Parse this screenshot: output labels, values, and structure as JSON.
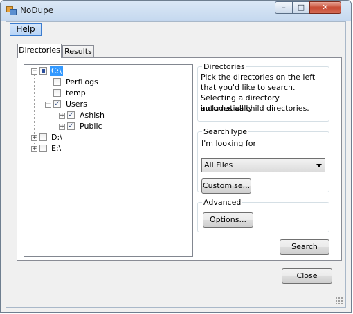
{
  "window": {
    "title": "NoDupe",
    "minimize_glyph": "–",
    "maximize_glyph": "□",
    "close_glyph": "✕"
  },
  "menu": {
    "help_label": "Help"
  },
  "tabs": [
    {
      "label": "Directories"
    },
    {
      "label": "Results"
    }
  ],
  "tree": {
    "nodes": [
      {
        "label": "C:\\",
        "selected": true,
        "check": "partial"
      },
      {
        "label": "PerfLogs",
        "check": "unchecked"
      },
      {
        "label": "temp",
        "check": "unchecked"
      },
      {
        "label": "Users",
        "check": "checked"
      },
      {
        "label": "Ashish",
        "check": "checked"
      },
      {
        "label": "Public",
        "check": "checked"
      },
      {
        "label": "D:\\",
        "check": "unchecked"
      },
      {
        "label": "E:\\",
        "check": "unchecked"
      }
    ]
  },
  "directories_group": {
    "legend": "Directories",
    "lines": [
      "Pick the directories on the left",
      "that you'd like to search.",
      "Selecting a directory automatically",
      "includes all child directories."
    ]
  },
  "search_type_group": {
    "legend": "SearchType",
    "prompt": "I'm looking for",
    "selected_option": "All Files",
    "customise_label": "Customise..."
  },
  "advanced_group": {
    "legend": "Advanced",
    "options_label": "Options..."
  },
  "search_label": "Search",
  "close_label": "Close",
  "colors": {
    "selection": "#3399ff",
    "close_button": "#c74a33"
  }
}
